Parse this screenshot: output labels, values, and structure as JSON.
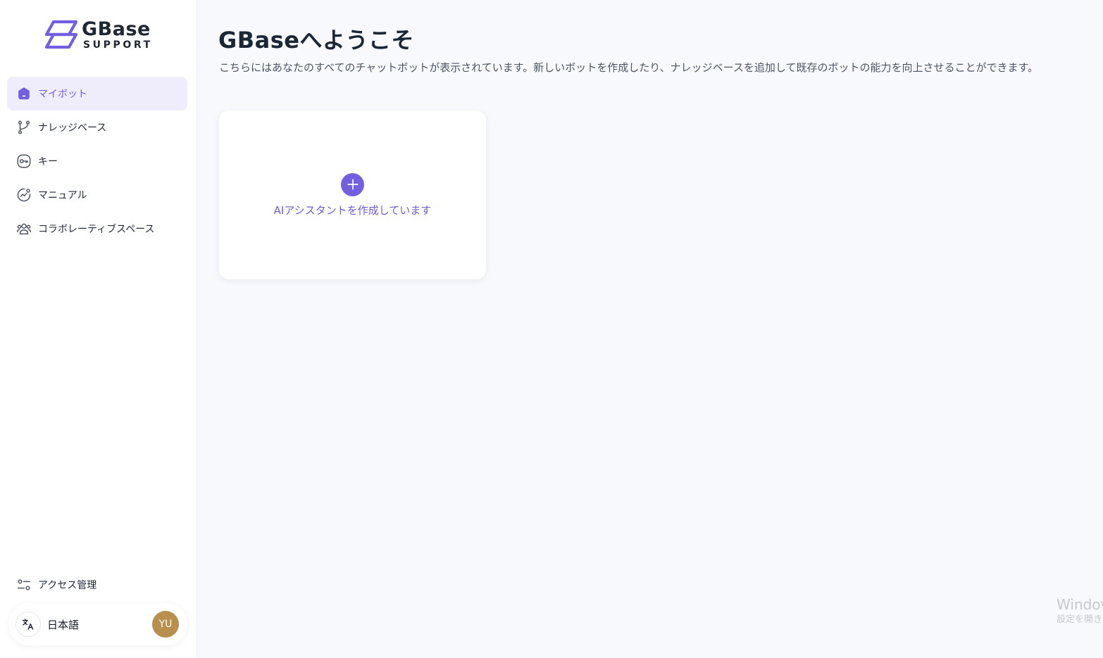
{
  "brand": {
    "name": "GBase",
    "sub": "SUPPORT",
    "accent_color": "#7360e0"
  },
  "sidebar": {
    "items": [
      {
        "label": "マイボット",
        "icon": "bot-icon",
        "active": true
      },
      {
        "label": "ナレッジベース",
        "icon": "branch-icon",
        "active": false
      },
      {
        "label": "キー",
        "icon": "key-icon",
        "active": false
      },
      {
        "label": "マニュアル",
        "icon": "chart-icon",
        "active": false
      },
      {
        "label": "コラボレーティブスペース",
        "icon": "users-icon",
        "active": false
      }
    ],
    "access_label": "アクセス管理",
    "language_label": "日本語",
    "avatar_initials": "YU"
  },
  "main": {
    "title": "GBaseへようこそ",
    "description": "こちらにはあなたのすべてのチャットボットが表示されています。新しいボットを作成したり、ナレッジベースを追加して既存のボットの能力を向上させることができます。",
    "create_label": "AIアシスタントを作成しています"
  },
  "watermark": {
    "line1": "Windov",
    "line2": "設定を開き"
  }
}
